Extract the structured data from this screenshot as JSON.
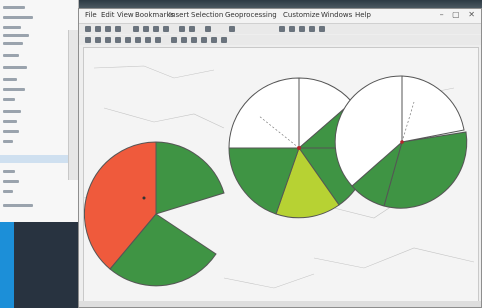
{
  "window": {
    "menu": [
      "File",
      "Edit",
      "View",
      "Bookmarks",
      "Insert",
      "Selection",
      "Geoprocessing",
      "Customize",
      "Windows",
      "Help"
    ],
    "controls": "–  ▢  ✕"
  },
  "map": {
    "theme": "pie charts overlaid on a map",
    "colors": {
      "green": "#3f9444",
      "lime": "#b7d233",
      "orange_red": "#ef5a3c",
      "empty_slice": "#ffffff",
      "outline": "#555555",
      "canvas": "#f4f4f4"
    }
  }
}
